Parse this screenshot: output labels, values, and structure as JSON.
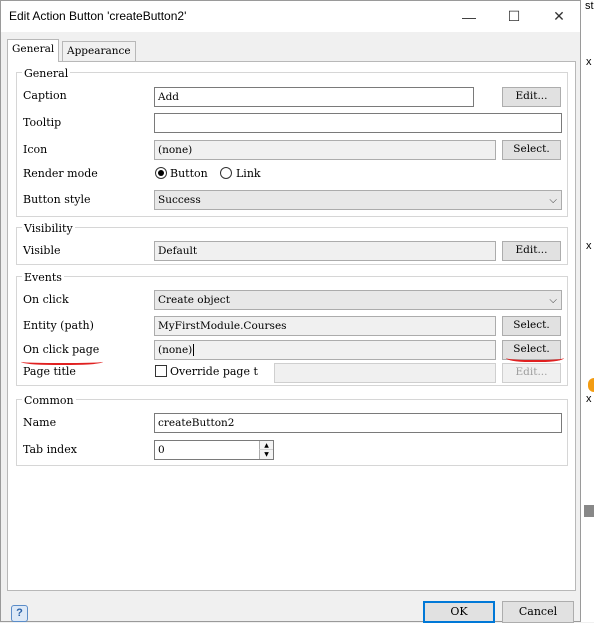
{
  "window": {
    "title": "Edit Action Button 'createButton2'"
  },
  "titlebar_buttons": {
    "minimize": "—",
    "maximize": "☐",
    "close": "✕"
  },
  "tabs": [
    {
      "label": "General"
    },
    {
      "label": "Appearance"
    }
  ],
  "groups": {
    "general": "General",
    "visibility": "Visibility",
    "events": "Events",
    "common": "Common"
  },
  "general": {
    "caption_label": "Caption",
    "caption_value": "Add",
    "caption_button": "Edit...",
    "tooltip_label": "Tooltip",
    "tooltip_value": "",
    "icon_label": "Icon",
    "icon_value": "(none)",
    "icon_button": "Select.",
    "render_mode_label": "Render mode",
    "render_mode_options": [
      "Button",
      "Link"
    ],
    "render_mode_selected": "Button",
    "button_style_label": "Button style",
    "button_style_value": "Success"
  },
  "visibility": {
    "visible_label": "Visible",
    "visible_value": "Default",
    "visible_button": "Edit..."
  },
  "events": {
    "on_click_label": "On click",
    "on_click_value": "Create object",
    "entity_label": "Entity (path)",
    "entity_value": "MyFirstModule.Courses",
    "entity_button": "Select.",
    "page_label": "On click page",
    "page_value": "(none)",
    "page_button": "Select.",
    "page_title_label": "Page title",
    "override_label": "Override page t",
    "override_checked": false,
    "page_title_button": "Edit..."
  },
  "common": {
    "name_label": "Name",
    "name_value": "createButton2",
    "tab_index_label": "Tab index",
    "tab_index_value": "0"
  },
  "footer": {
    "help": "?",
    "ok": "OK",
    "cancel": "Cancel"
  },
  "background": {
    "top_text": "st",
    "side_chars": [
      "x",
      "x",
      "x"
    ]
  },
  "colors": {
    "annotation": "#e02020",
    "default_button_border": "#0078d7",
    "orange_marker": "#f39c12"
  }
}
